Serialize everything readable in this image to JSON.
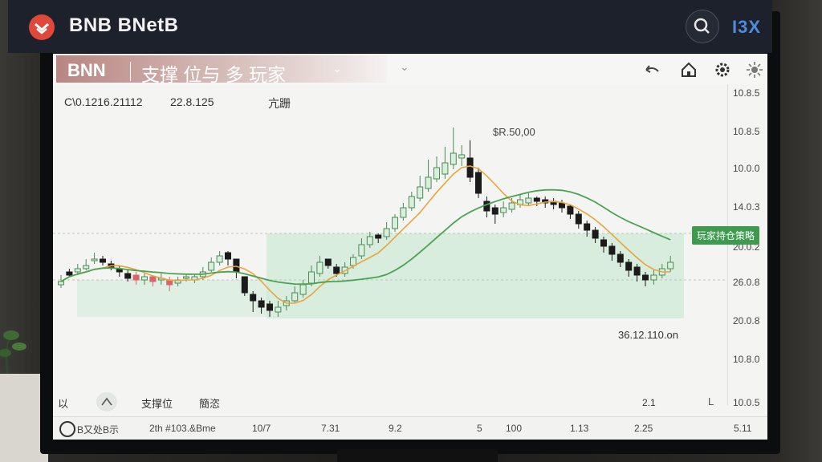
{
  "app": {
    "title": "BNB BNetB",
    "user_id": "I3X",
    "logo_icon": "exchange-logo-icon",
    "search_icon": "search-icon"
  },
  "chart_header": {
    "symbol": "BNN",
    "name": "支撑 位与 多 玩家",
    "tools": [
      "back-arrow-icon",
      "home-icon",
      "gear-icon",
      "sun-icon"
    ]
  },
  "ohlc": {
    "label": "C\\0.1216.21112",
    "value": "22.8.125",
    "extra": "亢跚"
  },
  "annotations": {
    "peak": "$R.50,00",
    "low": "36.12.110.on",
    "tag": "玩家持仓策略"
  },
  "bottom_tools": {
    "left": "以",
    "icon": "drawing-tool-icon",
    "support": "支撑位",
    "other": "簡恣",
    "right_a": "2.1",
    "right_b": "L"
  },
  "status_strip": {
    "left": "B又处B示",
    "info": "2th #103.&Bme",
    "right": "5.11"
  },
  "chart_data": {
    "type": "candlestick",
    "y_ticks": [
      "10.8.5",
      "10.8.5",
      "10.0.0",
      "14.0.3",
      "20.0.2",
      "26.0.8",
      "20.0.8",
      "10.8.0",
      "10.0.5"
    ],
    "x_ticks": [
      "10/7",
      "7.31",
      "9.2",
      "5",
      "100",
      "1.13",
      "2.25"
    ],
    "colors": {
      "up": "#d8efdc",
      "up_border": "#4c8a57",
      "down": "#1b1b1b",
      "red": "#d9646a",
      "ma_fast": "#e9a53a",
      "ma_slow": "#4aa352",
      "zone": "#cfead6"
    },
    "candles": [
      [
        52,
        50,
        56,
        48,
        1
      ],
      [
        58,
        56,
        60,
        55,
        0
      ],
      [
        60,
        58,
        63,
        56,
        1
      ],
      [
        62,
        60,
        66,
        59,
        1
      ],
      [
        66,
        65,
        70,
        63,
        1
      ],
      [
        64,
        66,
        68,
        62,
        0
      ],
      [
        61,
        63,
        65,
        59,
        0
      ],
      [
        58,
        60,
        62,
        55,
        0
      ],
      [
        54,
        57,
        59,
        52,
        0
      ],
      [
        53,
        56,
        58,
        50,
        2
      ],
      [
        55,
        53,
        57,
        50,
        1
      ],
      [
        52,
        55,
        56,
        49,
        2
      ],
      [
        53,
        54,
        57,
        50,
        1
      ],
      [
        50,
        53,
        55,
        46,
        2
      ],
      [
        53,
        51,
        55,
        49,
        1
      ],
      [
        55,
        54,
        57,
        52,
        1
      ],
      [
        55,
        53,
        57,
        51,
        1
      ],
      [
        58,
        55,
        61,
        53,
        1
      ],
      [
        64,
        59,
        67,
        58,
        1
      ],
      [
        68,
        64,
        71,
        62,
        1
      ],
      [
        66,
        70,
        71,
        62,
        0
      ],
      [
        58,
        66,
        66,
        54,
        0
      ],
      [
        45,
        55,
        55,
        43,
        0
      ],
      [
        40,
        44,
        46,
        33,
        0
      ],
      [
        36,
        40,
        42,
        32,
        0
      ],
      [
        34,
        38,
        40,
        30,
        0
      ],
      [
        36,
        33,
        40,
        30,
        1
      ],
      [
        40,
        37,
        43,
        34,
        1
      ],
      [
        45,
        40,
        49,
        39,
        1
      ],
      [
        50,
        44,
        53,
        42,
        1
      ],
      [
        58,
        51,
        62,
        49,
        1
      ],
      [
        64,
        57,
        68,
        55,
        1
      ],
      [
        62,
        66,
        66,
        60,
        0
      ],
      [
        57,
        61,
        63,
        55,
        0
      ],
      [
        61,
        57,
        64,
        55,
        1
      ],
      [
        67,
        62,
        69,
        60,
        1
      ],
      [
        75,
        68,
        79,
        66,
        1
      ],
      [
        80,
        75,
        83,
        73,
        1
      ],
      [
        79,
        81,
        82,
        76,
        0
      ],
      [
        85,
        80,
        89,
        78,
        1
      ],
      [
        92,
        85,
        94,
        83,
        1
      ],
      [
        98,
        92,
        101,
        90,
        1
      ],
      [
        105,
        98,
        108,
        96,
        1
      ],
      [
        111,
        104,
        118,
        102,
        1
      ],
      [
        117,
        110,
        128,
        108,
        1
      ],
      [
        123,
        116,
        130,
        114,
        1
      ],
      [
        126,
        119,
        136,
        116,
        1
      ],
      [
        132,
        125,
        148,
        122,
        1
      ],
      [
        129,
        131,
        137,
        124,
        1
      ],
      [
        117,
        129,
        140,
        114,
        0
      ],
      [
        107,
        120,
        123,
        104,
        0
      ],
      [
        96,
        102,
        105,
        92,
        0
      ],
      [
        94,
        98,
        100,
        88,
        0
      ],
      [
        98,
        95,
        102,
        92,
        1
      ],
      [
        101,
        97,
        104,
        95,
        1
      ],
      [
        103,
        100,
        106,
        98,
        1
      ],
      [
        104,
        101,
        107,
        99,
        1
      ],
      [
        102,
        104,
        105,
        99,
        0
      ],
      [
        101,
        103,
        105,
        98,
        0
      ],
      [
        100,
        102,
        104,
        97,
        0
      ],
      [
        98,
        101,
        103,
        95,
        0
      ],
      [
        94,
        99,
        100,
        91,
        0
      ],
      [
        88,
        94,
        96,
        85,
        0
      ],
      [
        84,
        88,
        90,
        80,
        0
      ],
      [
        79,
        84,
        86,
        76,
        0
      ],
      [
        74,
        78,
        80,
        70,
        0
      ],
      [
        69,
        74,
        76,
        65,
        0
      ],
      [
        64,
        69,
        71,
        61,
        0
      ],
      [
        59,
        64,
        66,
        55,
        0
      ],
      [
        56,
        61,
        63,
        52,
        0
      ],
      [
        53,
        56,
        58,
        49,
        0
      ],
      [
        56,
        53,
        59,
        50,
        1
      ],
      [
        60,
        56,
        63,
        54,
        1
      ],
      [
        64,
        60,
        68,
        58,
        1
      ]
    ]
  }
}
